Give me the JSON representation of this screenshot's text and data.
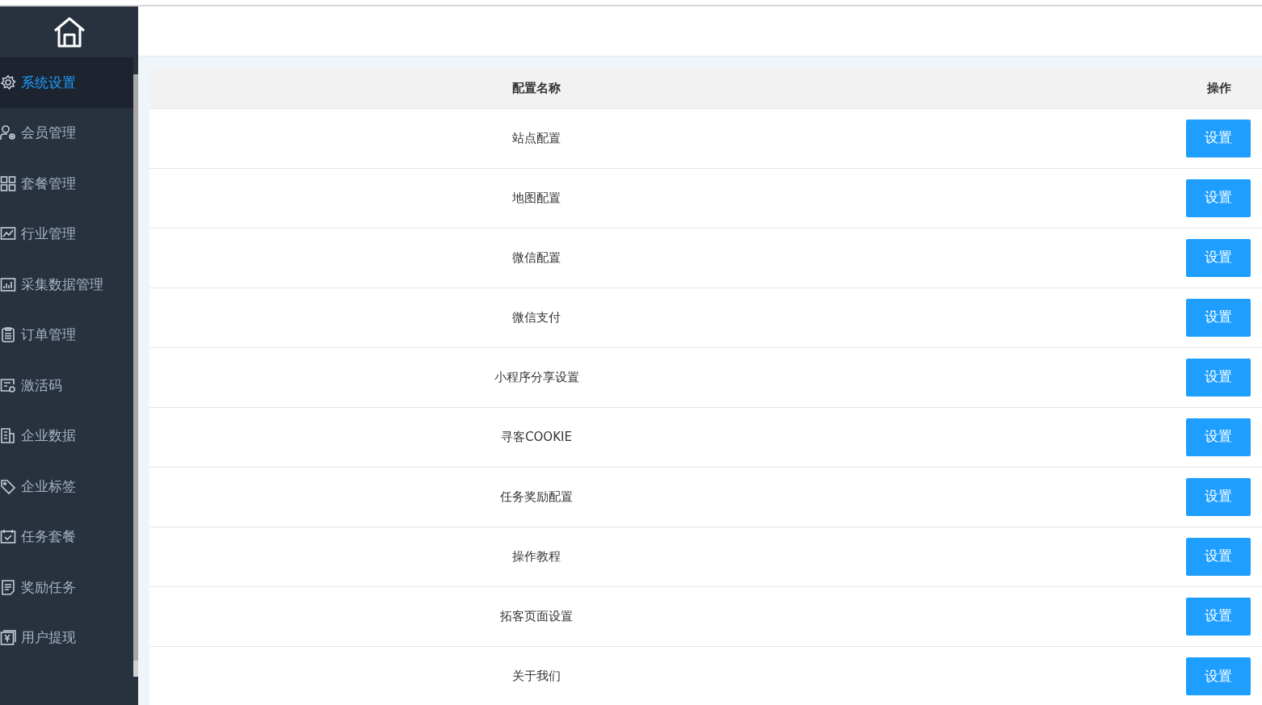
{
  "sidebar": {
    "items": [
      {
        "label": "系统设置",
        "selected": true
      },
      {
        "label": "会员管理",
        "selected": false
      },
      {
        "label": "套餐管理",
        "selected": false
      },
      {
        "label": "行业管理",
        "selected": false
      },
      {
        "label": "采集数据管理",
        "selected": false
      },
      {
        "label": "订单管理",
        "selected": false
      },
      {
        "label": "激活码",
        "selected": false
      },
      {
        "label": "企业数据",
        "selected": false
      },
      {
        "label": "企业标签",
        "selected": false
      },
      {
        "label": "任务套餐",
        "selected": false
      },
      {
        "label": "奖励任务",
        "selected": false
      },
      {
        "label": "用户提现",
        "selected": false
      }
    ]
  },
  "table": {
    "columns": [
      "配置名称",
      "操作"
    ],
    "rows": [
      {
        "name": "站点配置",
        "action": "设置"
      },
      {
        "name": "地图配置",
        "action": "设置"
      },
      {
        "name": "微信配置",
        "action": "设置"
      },
      {
        "name": "微信支付",
        "action": "设置"
      },
      {
        "name": "小程序分享设置",
        "action": "设置"
      },
      {
        "name": "寻客COOKIE",
        "action": "设置"
      },
      {
        "name": "任务奖励配置",
        "action": "设置"
      },
      {
        "name": "操作教程",
        "action": "设置"
      },
      {
        "name": "拓客页面设置",
        "action": "设置"
      },
      {
        "name": "关于我们",
        "action": "设置"
      }
    ]
  }
}
